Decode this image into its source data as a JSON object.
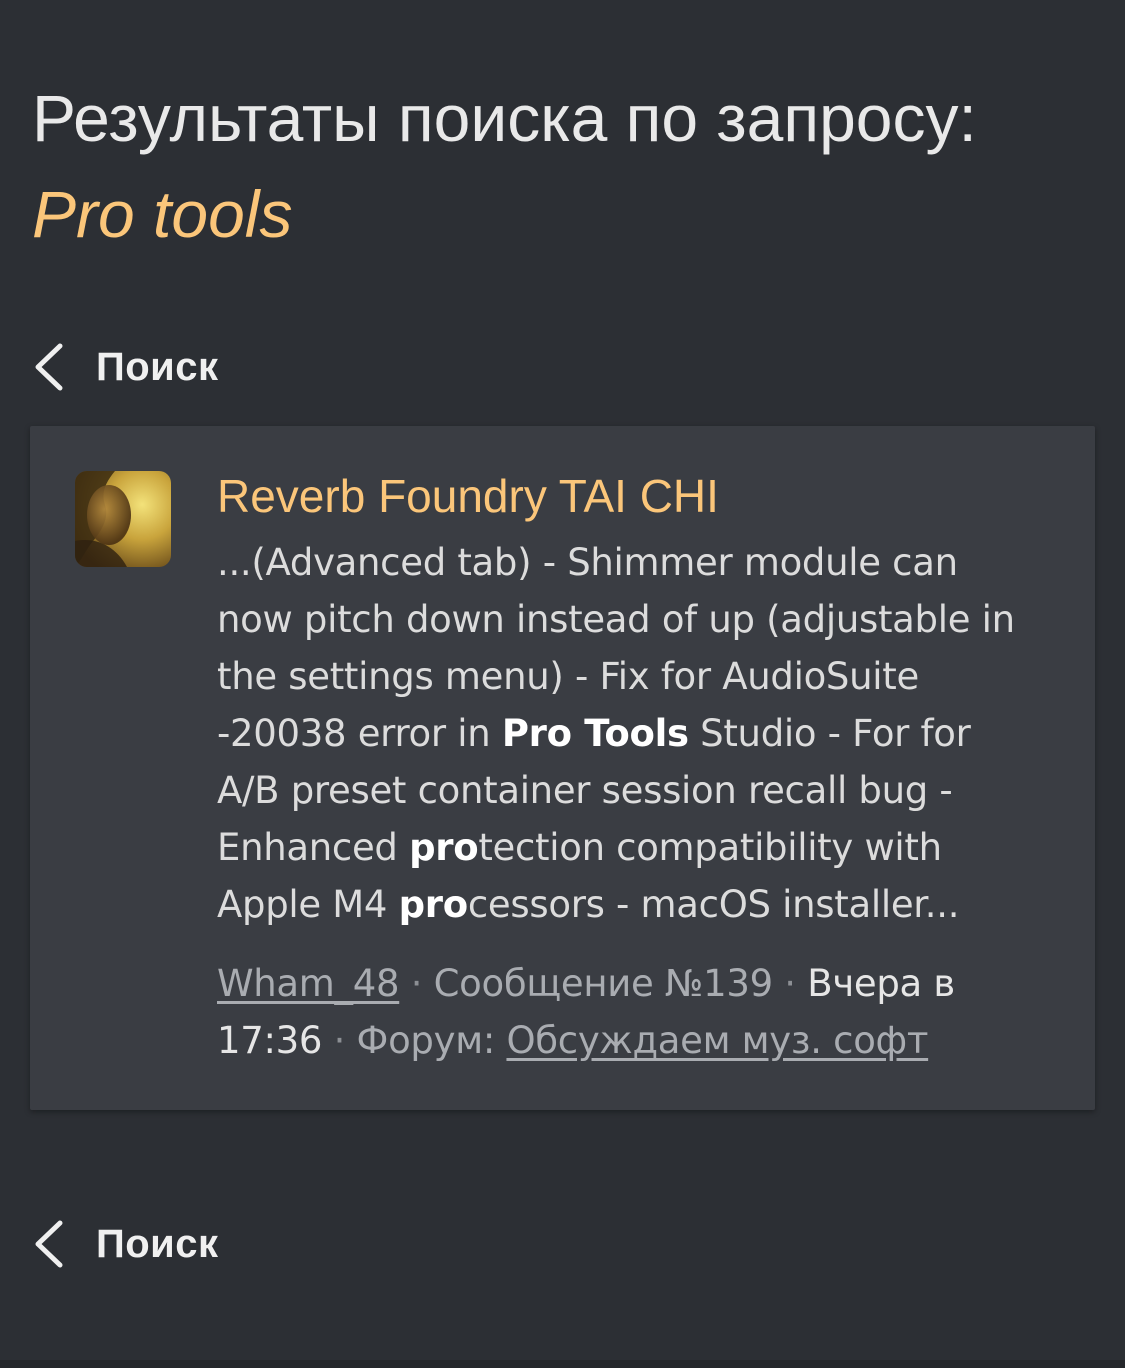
{
  "header": {
    "title": "Результаты поиска по запросу:",
    "query": "Pro tools"
  },
  "nav": {
    "back_label_top": "Поиск",
    "back_label_bottom": "Поиск"
  },
  "results": [
    {
      "title": "Reverb Foundry TAI CHI",
      "snippet": {
        "s1": "...(Advanced tab) - Shimmer module can now pitch down instead of up (adjustable in the settings menu) - Fix for AudioSuite -20038 error in ",
        "b1": "Pro Tools",
        "s2": " Studio - For for A/B preset container session recall bug - Enhanced ",
        "b2": "pro",
        "s3": "tection compatibility with Apple M4 ",
        "b3": "pro",
        "s4": "cessors - macOS installer..."
      },
      "author": "Wham_48",
      "separator": " · ",
      "message": "Сообщение №139",
      "date": "Вчера в 17:36",
      "forum_label": "Форум: ",
      "forum": "Обсуждаем муз. софт"
    }
  ],
  "icons": {
    "back": "chevron-left-icon",
    "avatar": "user-avatar-photo"
  },
  "colors": {
    "background": "#2c2f34",
    "card": "#3a3d43",
    "accent": "#fbc67a",
    "text": "#dcdcdc",
    "muted": "#a9acb1"
  }
}
